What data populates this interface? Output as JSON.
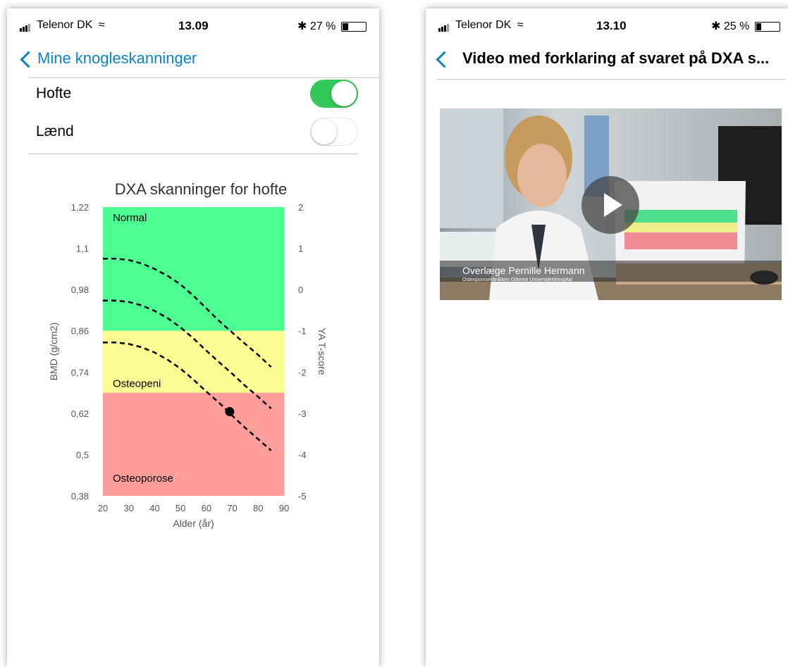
{
  "screen1": {
    "status": {
      "carrier": "Telenor DK",
      "time": "13.09",
      "battery": "27 %",
      "battery_level": 0.27
    },
    "nav": {
      "back_label": "Mine knogleskanninger"
    },
    "toggles": [
      {
        "label": "Hofte",
        "on": true
      },
      {
        "label": "Lænd",
        "on": false
      }
    ],
    "chart_title": "DXA skanninger for hofte",
    "chart_data": {
      "type": "line",
      "title": "DXA skanninger for hofte",
      "xlabel": "Alder (år)",
      "ylabel": "BMD (g/cm2)",
      "y2label": "YA T-score",
      "xlim": [
        20,
        90
      ],
      "ylim": [
        0.38,
        1.22
      ],
      "x_ticks": [
        "20",
        "30",
        "40",
        "50",
        "60",
        "70",
        "80",
        "90"
      ],
      "y_ticks": [
        "1,22",
        "1,1",
        "0,98",
        "0,86",
        "0,74",
        "0,62",
        "0,5",
        "0,38"
      ],
      "y2_ticks": [
        "2",
        "1",
        "0",
        "-1",
        "-2",
        "-3",
        "-4",
        "-5"
      ],
      "zones": [
        {
          "label": "Normal",
          "from": 0.86,
          "to": 1.22,
          "color": "#4dff93"
        },
        {
          "label": "Osteopeni",
          "from": 0.68,
          "to": 0.86,
          "color": "#fbfc94"
        },
        {
          "label": "Osteoporose",
          "from": 0.38,
          "to": 0.68,
          "color": "#ff9e9b"
        }
      ],
      "curves": [
        {
          "x": [
            20,
            25,
            30,
            35,
            40,
            45,
            50,
            55,
            60,
            65,
            70,
            75,
            80,
            85
          ],
          "y": [
            1.07,
            1.07,
            1.066,
            1.056,
            1.04,
            1.02,
            0.995,
            0.962,
            0.925,
            0.888,
            0.855,
            0.822,
            0.79,
            0.755
          ]
        },
        {
          "x": [
            20,
            25,
            30,
            35,
            40,
            45,
            50,
            55,
            60,
            65,
            70,
            75,
            80,
            85
          ],
          "y": [
            0.948,
            0.948,
            0.944,
            0.934,
            0.918,
            0.897,
            0.87,
            0.838,
            0.802,
            0.768,
            0.735,
            0.7,
            0.668,
            0.634
          ]
        },
        {
          "x": [
            20,
            25,
            30,
            35,
            40,
            45,
            50,
            55,
            60,
            65,
            70,
            75,
            80,
            85
          ],
          "y": [
            0.826,
            0.826,
            0.822,
            0.812,
            0.797,
            0.776,
            0.75,
            0.718,
            0.683,
            0.65,
            0.613,
            0.578,
            0.545,
            0.512
          ]
        }
      ],
      "point": {
        "x": 69,
        "y": 0.625
      },
      "colors": {
        "curve": "#000000",
        "point": "#000000"
      }
    }
  },
  "screen2": {
    "status": {
      "carrier": "Telenor DK",
      "time": "13.10",
      "battery": "25 %",
      "battery_level": 0.25
    },
    "nav": {
      "title": "Video med forklaring af svaret på DXA s..."
    },
    "video": {
      "caption_name": "Overlæge Pernille Hermann",
      "caption_place": "Osteoporoseklinikken Odense Universitetshospital"
    }
  },
  "colors": {
    "accent": "#0a84c6",
    "toggle_on": "#34c759"
  }
}
